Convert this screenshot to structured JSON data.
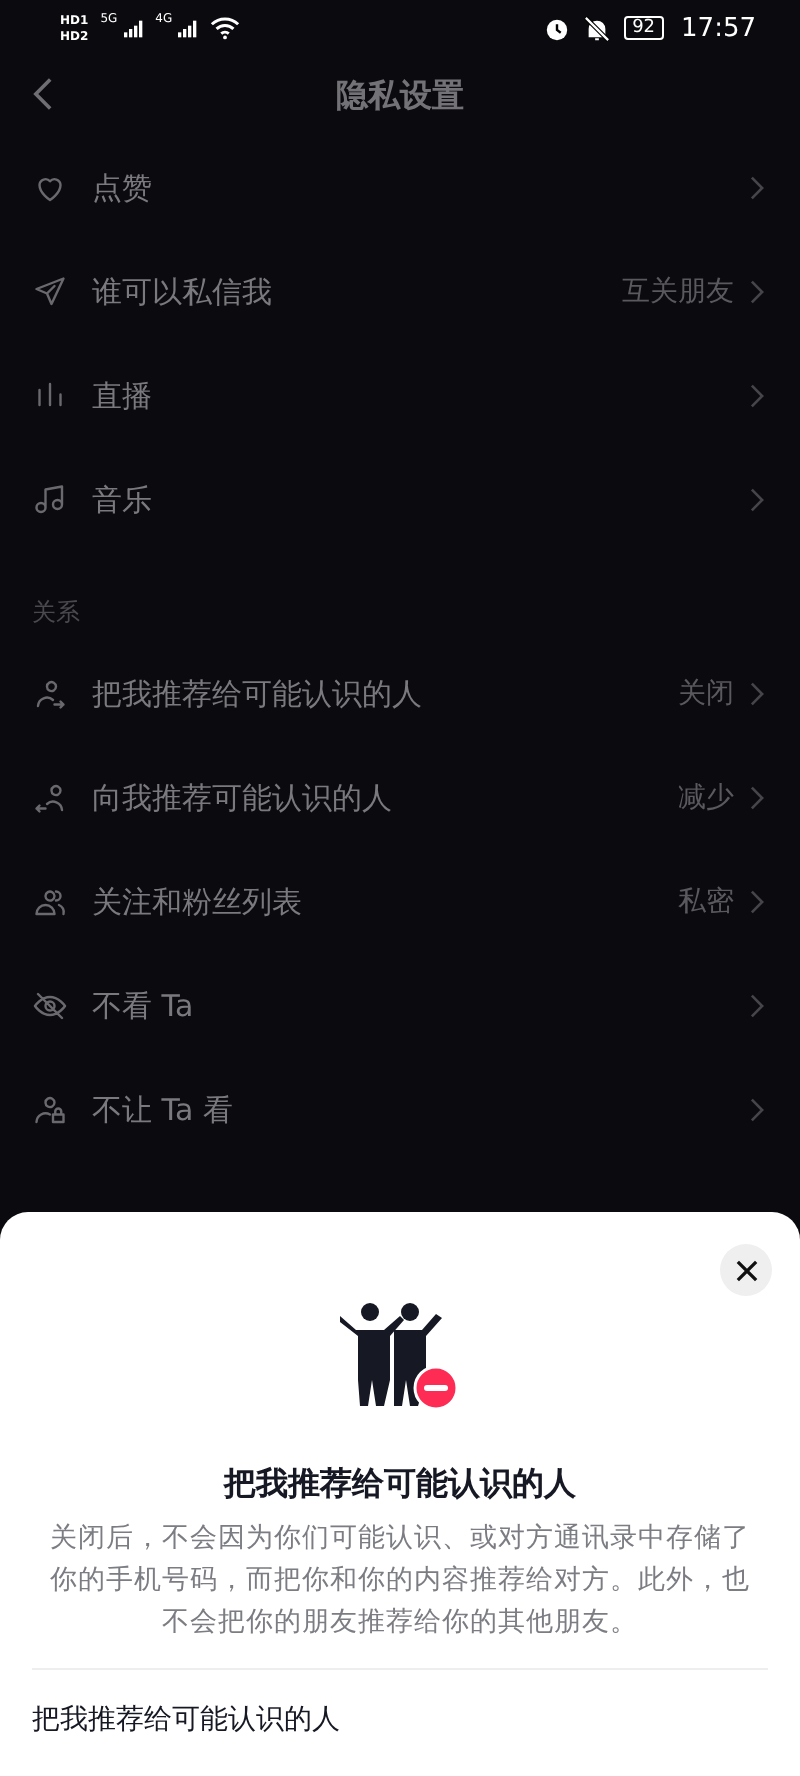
{
  "status_bar": {
    "sim_labels": [
      "HD1",
      "HD2"
    ],
    "networks": [
      "5G",
      "4G"
    ],
    "battery": "92",
    "time": "17:57"
  },
  "header": {
    "title": "隐私设置"
  },
  "groups": [
    {
      "items": [
        {
          "label": "点赞"
        },
        {
          "label": "谁可以私信我",
          "value": "互关朋友"
        },
        {
          "label": "直播"
        },
        {
          "label": "音乐"
        }
      ]
    },
    {
      "title": "关系",
      "items": [
        {
          "label": "把我推荐给可能认识的人",
          "value": "关闭"
        },
        {
          "label": "向我推荐可能认识的人",
          "value": "减少"
        },
        {
          "label": "关注和粉丝列表",
          "value": "私密"
        },
        {
          "label": "不看 Ta"
        },
        {
          "label": "不让 Ta 看"
        }
      ]
    }
  ],
  "sheet": {
    "title": "把我推荐给可能认识的人",
    "description": "关闭后，不会因为你们可能认识、或对方通讯录中存储了你的手机号码，而把你和你的内容推荐给对方。此外，也不会把你的朋友推荐给你的其他朋友。",
    "option": {
      "label": "把我推荐给可能认识的人"
    }
  }
}
